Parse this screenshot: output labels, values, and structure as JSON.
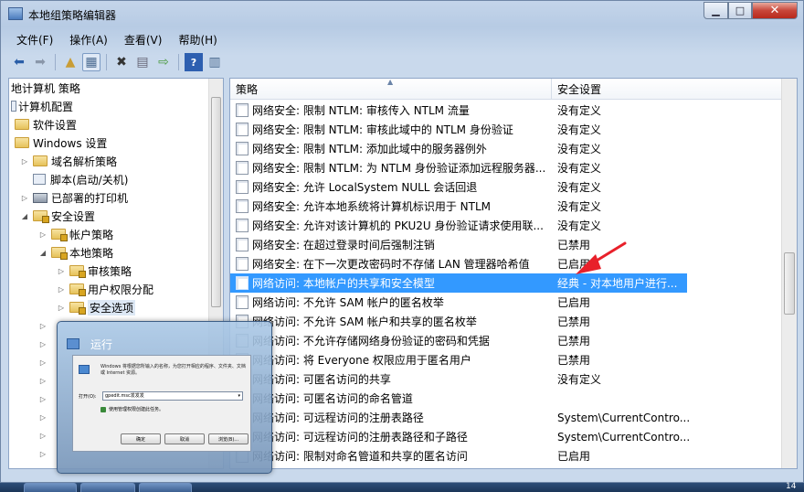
{
  "window": {
    "title": "本地组策略编辑器"
  },
  "menu": [
    "文件(F)",
    "操作(A)",
    "查看(V)",
    "帮助(H)"
  ],
  "toolbar": {
    "icons": [
      "back-arrow-icon",
      "forward-arrow-icon",
      "up-folder-icon",
      "show-hide-tree-icon",
      "delete-icon",
      "properties-icon",
      "export-list-icon",
      "help-icon",
      "show-action-pane-icon"
    ]
  },
  "tree": {
    "header": "地计算机 策略",
    "items": [
      {
        "label": "计算机配置",
        "depth": 0,
        "twisty": "",
        "icon": "computer"
      },
      {
        "label": "软件设置",
        "depth": 1,
        "twisty": "",
        "icon": "folder"
      },
      {
        "label": "Windows 设置",
        "depth": 1,
        "twisty": "",
        "icon": "folder"
      },
      {
        "label": "域名解析策略",
        "depth": 2,
        "twisty": "▷",
        "icon": "folder"
      },
      {
        "label": "脚本(启动/关机)",
        "depth": 2,
        "twisty": "",
        "icon": "script"
      },
      {
        "label": "已部署的打印机",
        "depth": 2,
        "twisty": "▷",
        "icon": "printer"
      },
      {
        "label": "安全设置",
        "depth": 2,
        "twisty": "◢",
        "icon": "lockfolder"
      },
      {
        "label": "帐户策略",
        "depth": 3,
        "twisty": "▷",
        "icon": "lockfolder"
      },
      {
        "label": "本地策略",
        "depth": 3,
        "twisty": "◢",
        "icon": "lockfolder"
      },
      {
        "label": "审核策略",
        "depth": 4,
        "twisty": "▷",
        "icon": "lockfolder"
      },
      {
        "label": "用户权限分配",
        "depth": 4,
        "twisty": "▷",
        "icon": "lockfolder"
      },
      {
        "label": "安全选项",
        "depth": 4,
        "twisty": "▷",
        "icon": "lockfolder"
      }
    ]
  },
  "list": {
    "columns": [
      "策略",
      "安全设置"
    ],
    "rows": [
      {
        "name": "网络安全: 限制 NTLM: 审核传入 NTLM 流量",
        "value": "没有定义"
      },
      {
        "name": "网络安全: 限制 NTLM: 审核此域中的 NTLM 身份验证",
        "value": "没有定义"
      },
      {
        "name": "网络安全: 限制 NTLM: 添加此域中的服务器例外",
        "value": "没有定义"
      },
      {
        "name": "网络安全: 限制 NTLM: 为 NTLM 身份验证添加远程服务器...",
        "value": "没有定义"
      },
      {
        "name": "网络安全: 允许 LocalSystem NULL 会话回退",
        "value": "没有定义"
      },
      {
        "name": "网络安全: 允许本地系统将计算机标识用于 NTLM",
        "value": "没有定义"
      },
      {
        "name": "网络安全: 允许对该计算机的 PKU2U 身份验证请求使用联...",
        "value": "没有定义"
      },
      {
        "name": "网络安全: 在超过登录时间后强制注销",
        "value": "已禁用"
      },
      {
        "name": "网络安全: 在下一次更改密码时不存储 LAN 管理器哈希值",
        "value": "已启用"
      },
      {
        "name": "网络访问: 本地帐户的共享和安全模型",
        "value": "经典 - 对本地用户进行..."
      },
      {
        "name": "网络访问: 不允许 SAM 帐户的匿名枚举",
        "value": "已启用"
      },
      {
        "name": "网络访问: 不允许 SAM 帐户和共享的匿名枚举",
        "value": "已禁用"
      },
      {
        "name": "网络访问: 不允许存储网络身份验证的密码和凭据",
        "value": "已禁用"
      },
      {
        "name": "网络访问: 将 Everyone 权限应用于匿名用户",
        "value": "已禁用"
      },
      {
        "name": "网络访问: 可匿名访问的共享",
        "value": "没有定义"
      },
      {
        "name": "网络访问: 可匿名访问的命名管道",
        "value": ""
      },
      {
        "name": "网络访问: 可远程访问的注册表路径",
        "value": "System\\CurrentContro..."
      },
      {
        "name": "网络访问: 可远程访问的注册表路径和子路径",
        "value": "System\\CurrentContro..."
      },
      {
        "name": "网络访问: 限制对命名管道和共享的匿名访问",
        "value": "已启用"
      }
    ],
    "selected_index": 9
  },
  "run_dialog": {
    "title": "运行",
    "description": "Windows 将根据您所输入的名称，为您打开相应的程序、文件夹、文档或 Internet 资源。",
    "open_label": "打开(O):",
    "input_value": "gpedit.msc发发发",
    "admin_note": "使用管理权限创建此任务。",
    "buttons": [
      "确定",
      "取消",
      "浏览(B)..."
    ]
  },
  "taskbar": {
    "clock": "14"
  },
  "colors": {
    "selection": "#3399ff",
    "annotation_arrow": "#e8202a"
  }
}
